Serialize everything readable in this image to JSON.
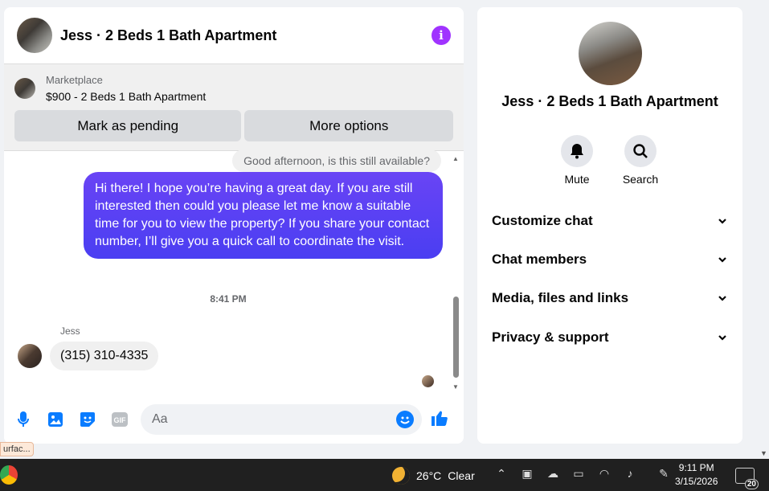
{
  "chat": {
    "title": "Jess · 2 Beds 1 Bath Apartment",
    "info_icon": "i",
    "marketplace": {
      "label": "Marketplace",
      "item": "$900 - 2 Beds 1 Bath Apartment",
      "pending_label": "Mark as pending",
      "more_label": "More options"
    },
    "messages": {
      "previous": "Good afternoon, is this still available?",
      "outgoing": "Hi there! I hope you’re having a great day. If you are still interested then could you please let me know a suitable time for you to view the property? If you share your contact number, I’ll give you a quick call to coordinate the visit.",
      "time": "8:41 PM",
      "sender": "Jess",
      "incoming": "(315) 310-4335"
    },
    "composer": {
      "placeholder": "Aa",
      "icons": [
        "microphone-icon",
        "image-icon",
        "sticker-icon",
        "gif-icon",
        "emoji-icon",
        "like-icon"
      ],
      "gif_text": "GIF"
    }
  },
  "details": {
    "title": "Jess · 2 Beds 1 Bath Apartment",
    "actions": [
      {
        "label": "Mute",
        "icon": "bell-icon"
      },
      {
        "label": "Search",
        "icon": "search-icon"
      }
    ],
    "sections": [
      "Customize chat",
      "Chat members",
      "Media, files and links",
      "Privacy & support"
    ]
  },
  "taskbar": {
    "tooltip": "urfac...",
    "temperature": "26°C",
    "condition": "Clear",
    "time": "9:11 PM",
    "date": "3/15/2026",
    "notifications": "20"
  },
  "colors": {
    "accent": "#0a7cff",
    "outgoing_bubble": "#4a3ef2",
    "info": "#a033ff"
  }
}
